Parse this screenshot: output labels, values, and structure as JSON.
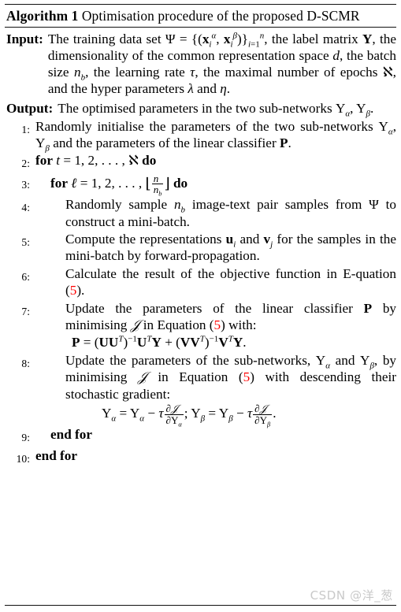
{
  "document": {
    "type": "algorithm-pseudocode-block",
    "title_prefix": "Algorithm 1",
    "title_text": "Optimisation procedure of the proposed D-SCMR",
    "title_full": "Algorithm 1 Optimisation procedure of the proposed D-SCMR"
  },
  "io": {
    "input_label": "Input:",
    "input_text": "The training data set Ψ = {(x_i^α, x_i^β)}_{i=1}^n, the label matrix Y, the dimensionality of the common representation space d, the batch size n_b, the learning rate τ, the maximal number of epochs ℵ, and the hyper parameters λ and η.",
    "output_label": "Output:",
    "output_text": "The optimised parameters in the two sub-networks Υ_α, Υ_β."
  },
  "steps": [
    {
      "num": "1:",
      "indent": 0,
      "text": "Randomly initialise the parameters of the two sub-networks Υ_α, Υ_β and the parameters of the linear classifier P."
    },
    {
      "num": "2:",
      "indent": 0,
      "text": "for t = 1, 2, …, ℵ do",
      "keywords": [
        "for",
        "do"
      ]
    },
    {
      "num": "3:",
      "indent": 1,
      "text": "for ℓ = 1, 2, …, ⌊n/n_b⌋ do",
      "keywords": [
        "for",
        "do"
      ]
    },
    {
      "num": "4:",
      "indent": 2,
      "text": "Randomly sample n_b image-text pair samples from Ψ to construct a mini-batch."
    },
    {
      "num": "5:",
      "indent": 2,
      "text": "Compute the representations u_i and v_j for the samples in the mini-batch by forward-propagation."
    },
    {
      "num": "6:",
      "indent": 2,
      "text": "Calculate the result of the objective function in Equation (5).",
      "eqref": "5"
    },
    {
      "num": "7:",
      "indent": 2,
      "text": "Update the parameters of the linear classifier P by minimising 𝒥 in Equation (5) with:",
      "eqref": "5",
      "equation": "P = (UU^T)^{-1}U^T Y + (VV^T)^{-1}V^T Y."
    },
    {
      "num": "8:",
      "indent": 2,
      "text": "Update the parameters of the sub-networks, Υ_α and Υ_β, by minimising 𝒥 in Equation (5) with descending their stochastic gradient:",
      "eqref": "5",
      "equation": "Υ_α = Υ_α − τ ∂𝒥/∂Υ_α ; Υ_β = Υ_β − τ ∂𝒥/∂Υ_β ."
    },
    {
      "num": "9:",
      "indent": 1,
      "text": "end for",
      "keywords": [
        "end for"
      ]
    },
    {
      "num": "10:",
      "indent": 0,
      "text": "end for",
      "keywords": [
        "end for"
      ]
    }
  ],
  "labels": {
    "step1_num": "1:",
    "step2_num": "2:",
    "step3_num": "3:",
    "step4_num": "4:",
    "step5_num": "5:",
    "step6_num": "6:",
    "step7_num": "7:",
    "step8_num": "8:",
    "step9_num": "9:",
    "step10_num": "10:",
    "end_for": "end for",
    "kw_for": "for",
    "kw_do": "do"
  },
  "watermark": {
    "text": "CSDN @洋_葱",
    "color": "#c9c9c9"
  },
  "colors": {
    "text": "#000000",
    "equation_reference": "#ff0000",
    "rule": "#111111",
    "background": "#ffffff"
  }
}
